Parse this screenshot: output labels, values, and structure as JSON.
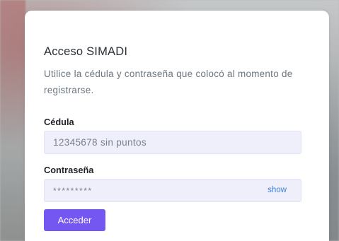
{
  "login": {
    "title": "Acceso SIMADI",
    "subtitle": "Utilice la cédula y contraseña que colocó al momento de registrarse.",
    "cedula_label": "Cédula",
    "cedula_placeholder": "12345678 sin puntos",
    "password_label": "Contraseña",
    "password_placeholder": "*********",
    "show_label": "show",
    "submit_label": "Acceder"
  },
  "colors": {
    "accent": "#7357f0",
    "input_bg": "#eeeffb",
    "link": "#3d7fd6"
  }
}
